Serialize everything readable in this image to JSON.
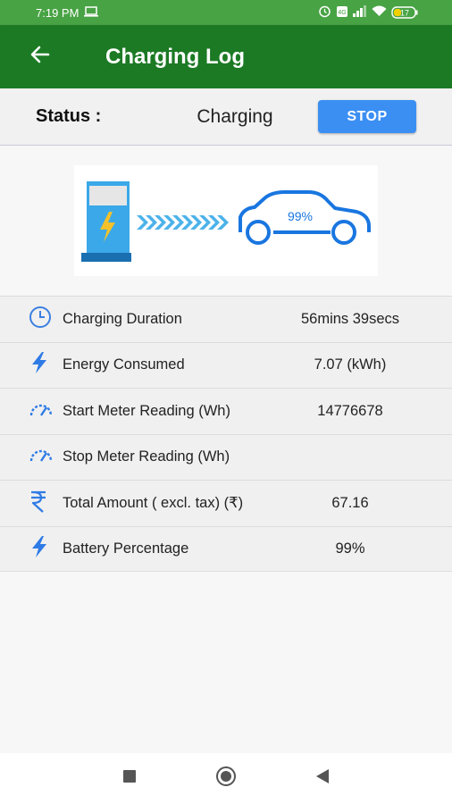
{
  "statusbar": {
    "time": "7:19 PM",
    "battery": "17"
  },
  "appbar": {
    "title": "Charging Log"
  },
  "status": {
    "label": "Status :",
    "value": "Charging",
    "stop_label": "STOP"
  },
  "hero": {
    "percent": "99%"
  },
  "rows": [
    {
      "icon": "clock-icon",
      "label": "Charging Duration",
      "value": "56mins 39secs"
    },
    {
      "icon": "lightning-icon",
      "label": "Energy Consumed",
      "value": "7.07 (kWh)"
    },
    {
      "icon": "speedometer-icon",
      "label": "Start Meter Reading (Wh)",
      "value": "14776678"
    },
    {
      "icon": "speedometer-icon",
      "label": "Stop Meter Reading (Wh)",
      "value": ""
    },
    {
      "icon": "rupee-icon",
      "label": "Total Amount ( excl. tax) (₹)",
      "value": "67.16"
    },
    {
      "icon": "lightning-icon",
      "label": "Battery Percentage",
      "value": "99%"
    }
  ],
  "colors": {
    "status_bar": "#48a344",
    "appbar": "#1c7a25",
    "accent": "#3b8ff3"
  }
}
